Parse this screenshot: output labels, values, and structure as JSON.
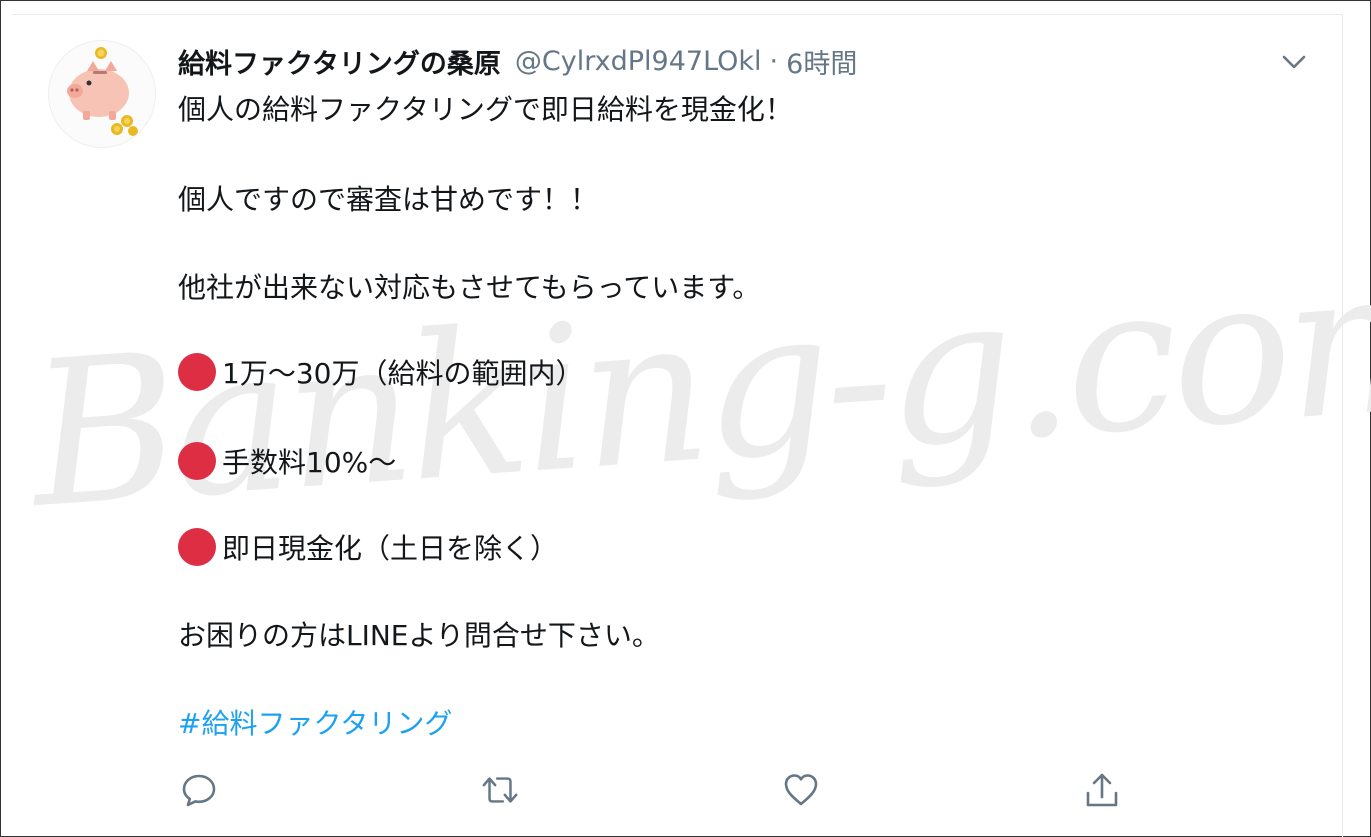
{
  "tweet": {
    "display_name": "給料ファクタリングの桑原",
    "handle": "@CylrxdPl947LOkl",
    "separator": "·",
    "time": "6時間",
    "lines": [
      "個人の給料ファクタリングで即日給料を現金化！",
      "個人ですので審査は甘めです！！",
      "他社が出来ない対応もさせてもらっています。",
      "1万～30万（給料の範囲内）",
      "手数料10%～",
      "即日現金化（土日を除く）",
      "お困りの方はLINEより問合せ下さい。"
    ],
    "hashtag": "#給料ファクタリング"
  },
  "watermark": "Banking-g.com",
  "actions": {
    "reply_icon": "reply-icon",
    "retweet_icon": "retweet-icon",
    "like_icon": "heart-icon",
    "share_icon": "share-icon"
  },
  "colors": {
    "text": "#14171a",
    "secondary": "#657786",
    "link": "#1da1f2",
    "bullet": "#dd2e44"
  }
}
